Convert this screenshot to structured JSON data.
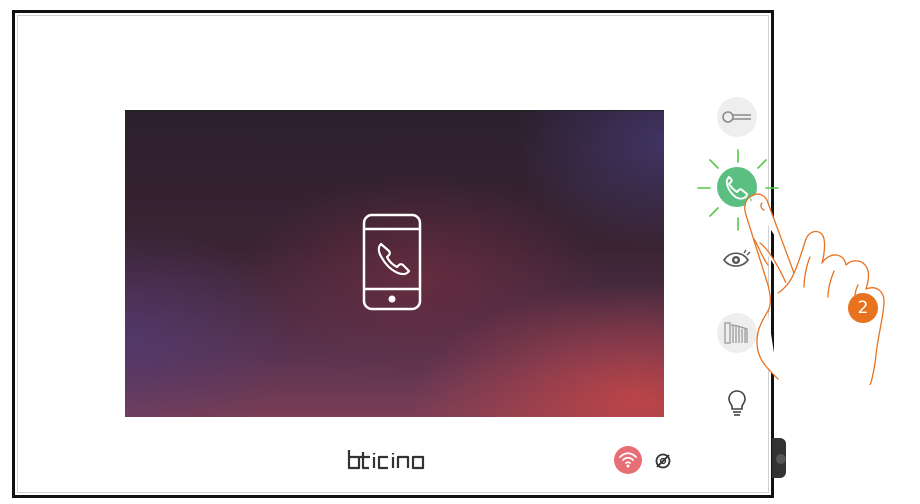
{
  "screen": {
    "status_icon": "smartphone-call-icon"
  },
  "side_buttons": [
    {
      "name": "door-lock",
      "icon": "key-icon"
    },
    {
      "name": "answer",
      "icon": "phone-handset-icon",
      "state": "flashing-green"
    },
    {
      "name": "camera",
      "icon": "eye-icon"
    },
    {
      "name": "gate",
      "icon": "gate-icon"
    },
    {
      "name": "light",
      "icon": "light-bulb-icon"
    }
  ],
  "brand": {
    "text": "bticino"
  },
  "indicators": {
    "wifi": "wifi-icon",
    "mute": "muted-icon"
  },
  "instruction": {
    "step": "2",
    "step_color": "#e8731f"
  },
  "colors": {
    "answer_active": "#5cbf82",
    "burst": "#55c84a",
    "wifi_bg": "#e86e76",
    "hand_outline": "#e8731f"
  }
}
